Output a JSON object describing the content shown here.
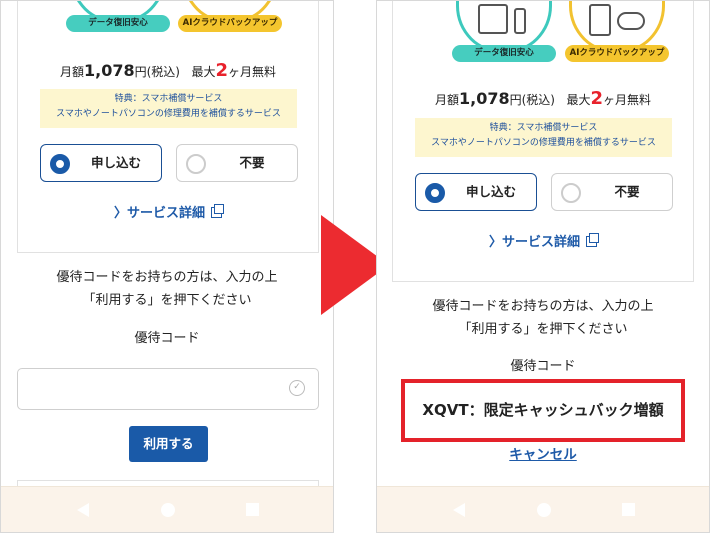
{
  "features": {
    "data_recovery": "データ復旧安心",
    "ai_cloud_backup": "AIクラウドバックアップ"
  },
  "price": {
    "monthly_prefix": "月額",
    "amount": "1,078",
    "yen_tax": "円(税込)",
    "max_prefix": "最大",
    "months": "2",
    "months_suffix": "ヶ月無料"
  },
  "benefit": {
    "line1": "特典：スマホ補償サービス",
    "line2": "スマホやノートパソコンの修理費用を補償するサービス"
  },
  "options": {
    "apply": "申し込む",
    "decline": "不要"
  },
  "service_link": "サービス詳細",
  "coupon": {
    "note_line1": "優待コードをお持ちの方は、入力の上",
    "note_line2": "「利用する」を押下ください",
    "label": "優待コード",
    "input_value": "",
    "use_button": "利用する",
    "applied_text": "XQVT：限定キャッシュバック増額",
    "cancel": "キャンセル"
  },
  "colors": {
    "primary": "#1a5aa8",
    "highlight": "#e4222a",
    "arrow": "#ec2b30",
    "benefit_bg": "#fdf6cf"
  }
}
